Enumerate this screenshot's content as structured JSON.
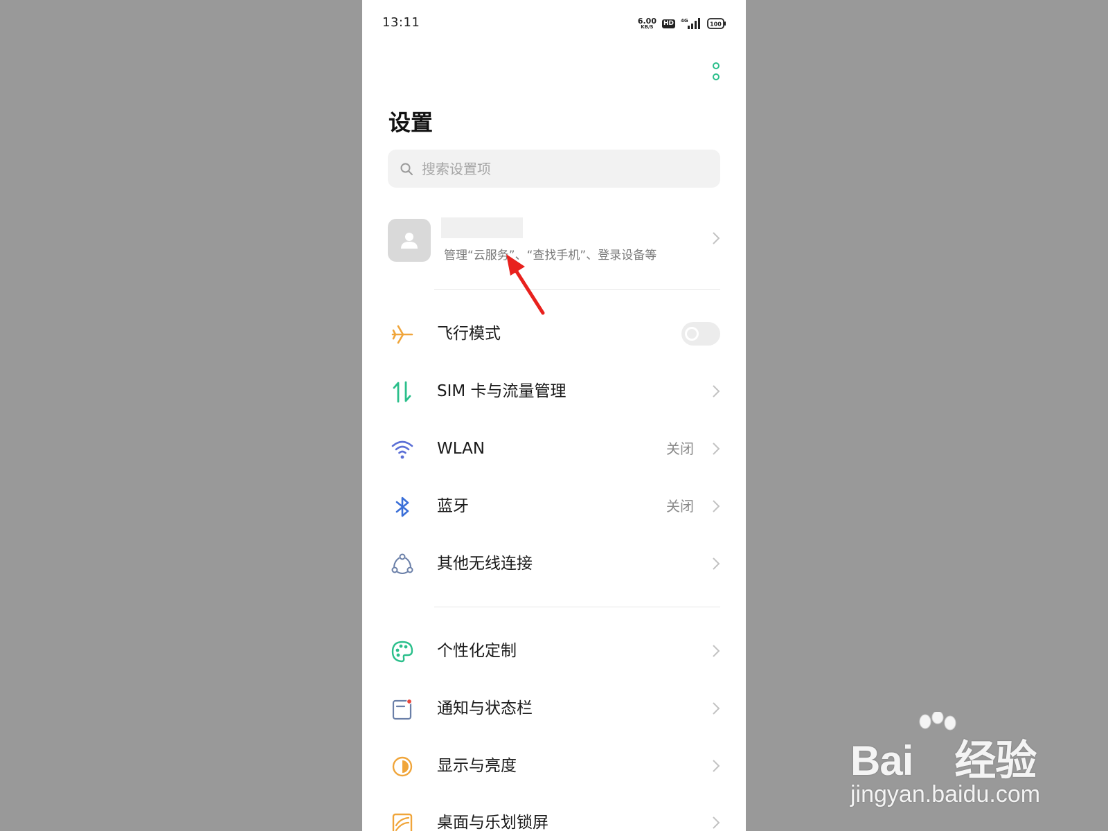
{
  "status_bar": {
    "time": "13:11",
    "net_speed_value": "6.00",
    "net_speed_unit": "KB/S",
    "hd_label": "HD",
    "network_type": "4G",
    "battery_level": "100"
  },
  "header": {
    "title": "设置",
    "more_icon": "more-vertical-icon"
  },
  "search": {
    "placeholder": "搜索设置项",
    "value": ""
  },
  "account": {
    "description": "管理“云服务”、“查找手机”、登录设备等"
  },
  "settings_group_1": [
    {
      "icon": "airplane-icon",
      "label": "飞行模式",
      "control": "toggle",
      "toggle_on": false,
      "icon_color": "#f0a53a"
    },
    {
      "icon": "sim-data-icon",
      "label": "SIM 卡与流量管理",
      "control": "chevron",
      "icon_color": "#2bbf8b"
    },
    {
      "icon": "wifi-icon",
      "label": "WLAN",
      "value": "关闭",
      "control": "chevron",
      "icon_color": "#5b6fd6"
    },
    {
      "icon": "bluetooth-icon",
      "label": "蓝牙",
      "value": "关闭",
      "control": "chevron",
      "icon_color": "#3a6fd8"
    },
    {
      "icon": "other-wireless-icon",
      "label": "其他无线连接",
      "control": "chevron",
      "icon_color": "#6a7fa8"
    }
  ],
  "settings_group_2": [
    {
      "icon": "palette-icon",
      "label": "个性化定制",
      "control": "chevron",
      "icon_color": "#2bbf8b"
    },
    {
      "icon": "notification-icon",
      "label": "通知与状态栏",
      "control": "chevron",
      "icon_color": "#6a7fa8"
    },
    {
      "icon": "brightness-icon",
      "label": "显示与亮度",
      "control": "chevron",
      "icon_color": "#f0a53a"
    },
    {
      "icon": "desktop-lockscreen-icon",
      "label": "桌面与乐划锁屏",
      "control": "chevron",
      "icon_color": "#f0a53a"
    }
  ],
  "colors": {
    "accent": "#2bbf8b",
    "annotation_arrow": "#e8211d",
    "background": "#999999"
  },
  "watermark": {
    "logo": "Bai 经验",
    "url": "jingyan.baidu.com"
  }
}
